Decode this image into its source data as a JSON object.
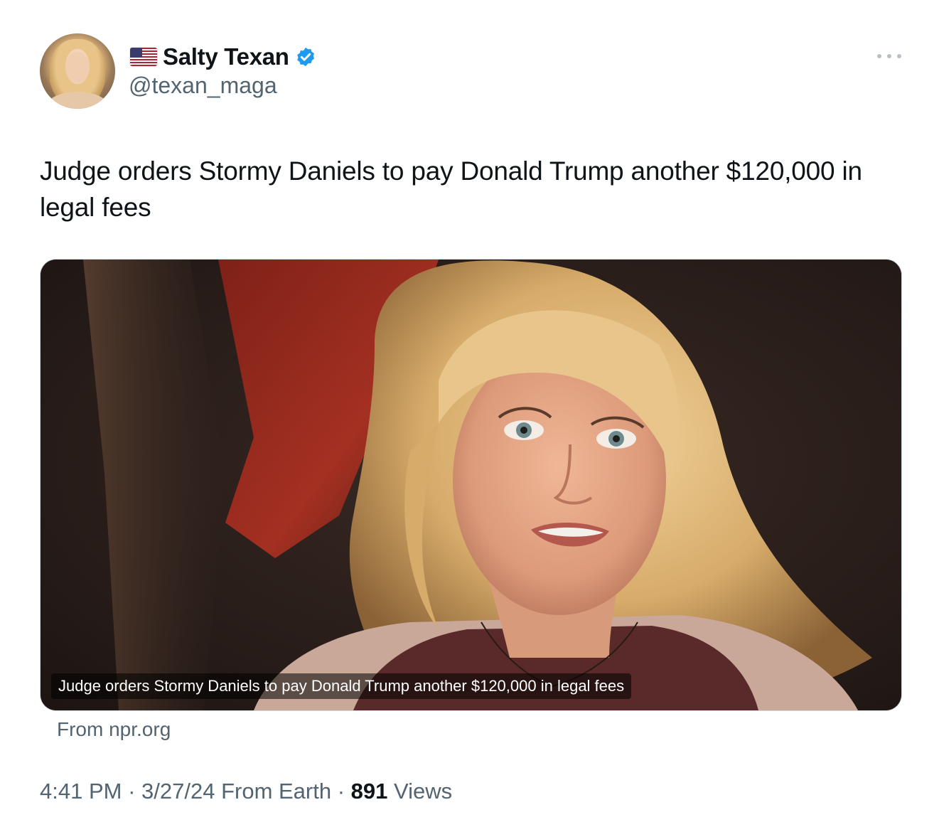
{
  "author": {
    "flag_icon": "us-flag-icon",
    "display_name": "Salty Texan",
    "verified_icon": "verified-badge-icon",
    "handle": "@texan_maga"
  },
  "menu": {
    "icon": "more-options-icon"
  },
  "tweet": {
    "text": "Judge orders Stormy Daniels to pay Donald Trump another $120,000 in legal fees"
  },
  "link_card": {
    "caption": "Judge orders Stormy Daniels to pay Donald Trump another $120,000 in legal fees",
    "source": "From npr.org"
  },
  "meta": {
    "time": "4:41 PM",
    "separator": " · ",
    "date": "3/27/24",
    "client": " From Earth",
    "views_count": "891",
    "views_label": " Views"
  },
  "colors": {
    "text_primary": "#0f1419",
    "text_secondary": "#536471",
    "verified_blue": "#1d9bf0"
  }
}
